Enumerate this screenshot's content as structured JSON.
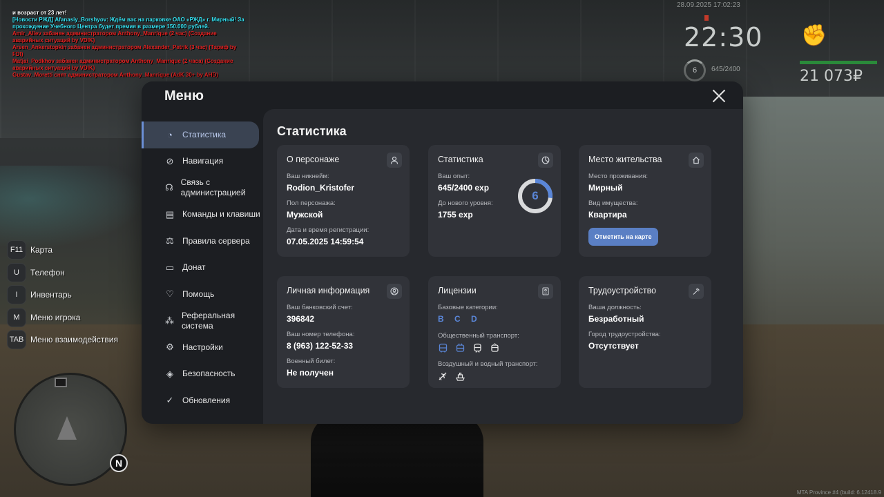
{
  "chat": [
    {
      "text": " и возраст от 23 лет!",
      "color": "#ffffff"
    },
    {
      "text": "[Новости РЖД] Afanasiy_Borshyov: Ждём вас на парковке ОАО «РЖД» г. Мирный! За прохождение Учебного Центра будет премия в размере 150.000 рублей.",
      "color": "#33e0f0"
    },
    {
      "text": "Amir_Aliev забанен администратором Anthony_Manrique (2 час) (Создание аварийных ситуаций by VDIK)",
      "color": "#e02020"
    },
    {
      "text": "Arsen_Ankerstopkin забанен администратором Alexander_Petrik (3 час) (Тариф by FDI)",
      "color": "#e02020"
    },
    {
      "text": "Matjai_Podkhov забанен администратором Anthony_Manrique (2 часа) (Создание аварийных ситуаций by VDIK)",
      "color": "#e02020"
    },
    {
      "text": "Gustav_Moretti снят администратором Anthony_Manrique (AdK 30+ by AHD)",
      "color": "#e02020"
    }
  ],
  "hud": {
    "date": "28.09.2025 17:02:23",
    "time": "22:30",
    "level": "6",
    "exp": "645/2400",
    "money": "21 073₽"
  },
  "keybinds": [
    {
      "key": "F11",
      "label": "Карта"
    },
    {
      "key": "U",
      "label": "Телефон"
    },
    {
      "key": "I",
      "label": "Инвентарь"
    },
    {
      "key": "M",
      "label": "Меню игрока"
    },
    {
      "key": "TAB",
      "label": "Меню взаимодействия"
    }
  ],
  "minimap": {
    "north": "N"
  },
  "build": "MTA Province #4 (build: 6.12418.9",
  "menu": {
    "title": "Меню",
    "sidebar": [
      {
        "label": "Статистика",
        "icon": "pie-chart-icon",
        "glyph": "◔"
      },
      {
        "label": "Навигация",
        "icon": "compass-icon",
        "glyph": "⊘"
      },
      {
        "label": "Связь с администрацией",
        "icon": "headset-icon",
        "glyph": "☊"
      },
      {
        "label": "Команды и клавиши",
        "icon": "document-icon",
        "glyph": "▤"
      },
      {
        "label": "Правила сервера",
        "icon": "scales-icon",
        "glyph": "⚖"
      },
      {
        "label": "Донат",
        "icon": "wallet-icon",
        "glyph": "▭"
      },
      {
        "label": "Помощь",
        "icon": "heart-hand-icon",
        "glyph": "♡"
      },
      {
        "label": "Реферальная система",
        "icon": "network-icon",
        "glyph": "⁂"
      },
      {
        "label": "Настройки",
        "icon": "gear-icon",
        "glyph": "⚙"
      },
      {
        "label": "Безопасность",
        "icon": "shield-icon",
        "glyph": "◈"
      },
      {
        "label": "Обновления",
        "icon": "check-circle-icon",
        "glyph": "✓"
      }
    ],
    "active_index": 0,
    "content_title": "Статистика",
    "cards": {
      "character": {
        "title": "О персонаже",
        "icon": "user-icon",
        "nick_label": "Ваш никнейм:",
        "nick": "Rodion_Kristofer",
        "gender_label": "Пол персонажа:",
        "gender": "Мужской",
        "reg_label": "Дата и время регистрации:",
        "reg": "07.05.2025 14:59:54"
      },
      "stats": {
        "title": "Статистика",
        "icon": "pie-chart-icon",
        "exp_label": "Ваш опыт:",
        "exp": "645/2400 exp",
        "next_label": "До нового уровня:",
        "next": "1755 exp",
        "level": "6",
        "progress": 0.27
      },
      "residence": {
        "title": "Место жительства",
        "icon": "home-icon",
        "place_label": "Место проживания:",
        "place": "Мирный",
        "property_label": "Вид имущества:",
        "property": "Квартира",
        "button": "Отметить на карте"
      },
      "personal": {
        "title": "Личная информация",
        "icon": "user-circle-icon",
        "bank_label": "Ваш банковский счет:",
        "bank": "396842",
        "phone_label": "Ваш номер телефона:",
        "phone": "8 (963) 122-52-33",
        "military_label": "Военный билет:",
        "military": "Не получен"
      },
      "licenses": {
        "title": "Лицензии",
        "icon": "license-icon",
        "base_label": "Базовые категории:",
        "base": "B C D",
        "public_label": "Общественный транспорт:",
        "air_label": "Воздушный и водный транспорт:"
      },
      "job": {
        "title": "Трудоустройство",
        "icon": "hammer-icon",
        "position_label": "Ваша должность:",
        "position": "Безработный",
        "employer_label": "Город трудоустройства:",
        "employer": "Отсутствует"
      }
    }
  }
}
